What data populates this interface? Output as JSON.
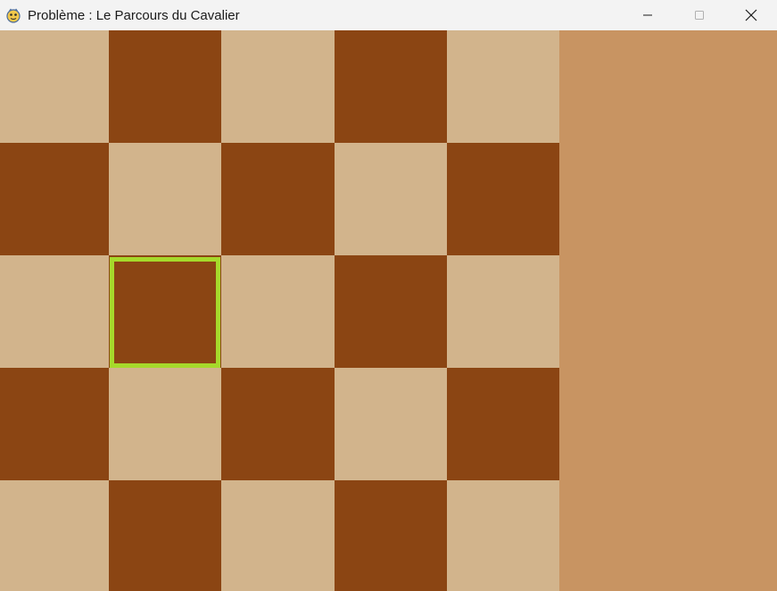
{
  "window": {
    "title": "Problème : Le Parcours du Cavalier",
    "icon": "python-game-icon",
    "controls": [
      "minimize-icon",
      "maximize-icon",
      "close-icon"
    ]
  },
  "board": {
    "rows": 5,
    "cols": 5,
    "light_color": "#d2b48c",
    "dark_color": "#8b4513",
    "panel_color": "#c89462",
    "highlight_color": "#a6d92b",
    "selected_square": {
      "row": 3,
      "col": 2
    }
  }
}
